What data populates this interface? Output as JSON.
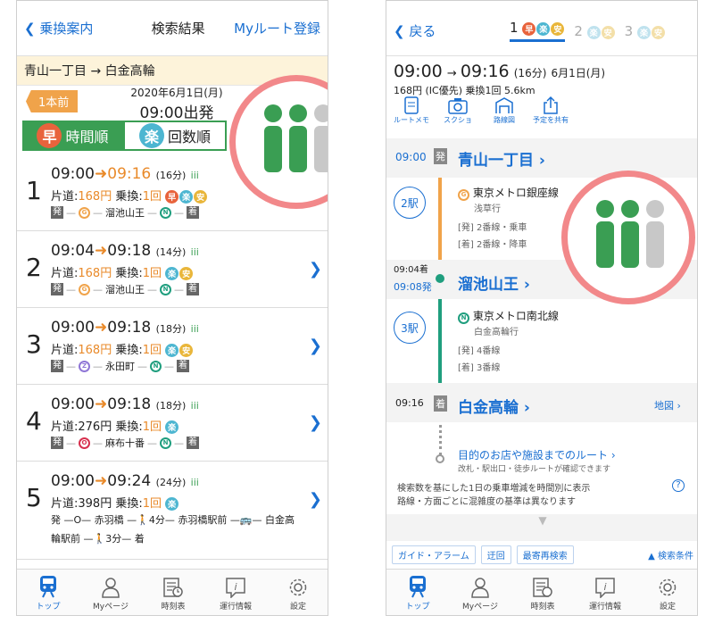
{
  "left": {
    "nav": {
      "back": "乗換案内",
      "title": "検索結果",
      "myroute": "Myルート登録"
    },
    "route": "青山一丁目 → 白金高輪",
    "prev": "1本前",
    "date": "2020年6月1日(月)",
    "depart": "09:00出発",
    "tabs": [
      {
        "badge": "早",
        "label": "時間順"
      },
      {
        "badge": "楽",
        "label": "回数順"
      }
    ],
    "routes": [
      {
        "num": "1",
        "dep": "09:00",
        "arr": "09:16",
        "dur": "(16分)",
        "fare_label": "片道:",
        "fare": "168円",
        "transfer_label": "乗換:",
        "transfer": "1回",
        "badges": [
          "早",
          "楽",
          "安"
        ],
        "arr_orange": true,
        "fare_orange": true,
        "path": [
          "発",
          "G",
          "溜池山王",
          "N",
          "着"
        ]
      },
      {
        "num": "2",
        "dep": "09:04",
        "arr": "09:18",
        "dur": "(14分)",
        "fare_label": "片道:",
        "fare": "168円",
        "transfer_label": "乗換:",
        "transfer": "1回",
        "badges": [
          "楽",
          "安"
        ],
        "arr_orange": false,
        "fare_orange": true,
        "path": [
          "発",
          "G",
          "溜池山王",
          "N",
          "着"
        ]
      },
      {
        "num": "3",
        "dep": "09:00",
        "arr": "09:18",
        "dur": "(18分)",
        "fare_label": "片道:",
        "fare": "168円",
        "transfer_label": "乗換:",
        "transfer": "1回",
        "badges": [
          "楽",
          "安"
        ],
        "arr_orange": false,
        "fare_orange": true,
        "path": [
          "発",
          "Z",
          "永田町",
          "N",
          "着"
        ]
      },
      {
        "num": "4",
        "dep": "09:00",
        "arr": "09:18",
        "dur": "(18分)",
        "fare_label": "片道:",
        "fare": "276円",
        "transfer_label": "乗換:",
        "transfer": "1回",
        "badges": [
          "楽"
        ],
        "arr_orange": false,
        "fare_orange": false,
        "path": [
          "発",
          "O",
          "麻布十番",
          "N",
          "着"
        ]
      },
      {
        "num": "5",
        "dep": "09:00",
        "arr": "09:24",
        "dur": "(24分)",
        "fare_label": "片道:",
        "fare": "398円",
        "transfer_label": "乗換:",
        "transfer": "1回",
        "badges": [
          "楽"
        ],
        "arr_orange": false,
        "fare_orange": false,
        "path5a": "発 —O— 赤羽橋 —🚶4分— 赤羽橋駅前 —🚌— 白金高",
        "path5b": "輪駅前 —🚶3分— 着"
      }
    ],
    "tabbar": [
      {
        "label": "トップ",
        "icon": "train-icon"
      },
      {
        "label": "Myページ",
        "icon": "person-icon"
      },
      {
        "label": "時刻表",
        "icon": "timetable-icon"
      },
      {
        "label": "運行情報",
        "icon": "info-icon"
      },
      {
        "label": "設定",
        "icon": "gear-icon"
      }
    ]
  },
  "right": {
    "nav": {
      "back": "戻る",
      "seg1": "1",
      "seg2": "2",
      "seg3": "3"
    },
    "summary": {
      "dep": "09:00",
      "arr": "09:16",
      "dur": "(16分)",
      "date": "6月1日(月)",
      "sub": "168円 (IC優先) 乗換1回 5.6km"
    },
    "tools": [
      "ルートメモ",
      "スクショ",
      "路線図",
      "予定を共有"
    ],
    "st1": {
      "time": "09:00",
      "mark": "発",
      "name": "青山一丁目 ›"
    },
    "leg1": {
      "count": "2駅",
      "line": "東京メトロ銀座線",
      "dir": "浅草行",
      "dep": "[発] 2番線・乗車",
      "arr": "[着] 2番線・降車"
    },
    "st2": {
      "arr": "09:04着",
      "dep": "09:08発",
      "name": "溜池山王 ›"
    },
    "leg2": {
      "count": "3駅",
      "line": "東京メトロ南北線",
      "dir": "白金高輪行",
      "dep": "[発] 4番線",
      "arr": "[着] 3番線"
    },
    "st3": {
      "time": "09:16",
      "mark": "着",
      "name": "白金高輪 ›",
      "map": "地図 ›"
    },
    "dest": {
      "title": "目的のお店や施設までのルート ›",
      "sub": "改札・駅出口・徒歩ルートが確認できます"
    },
    "note": {
      "l1": "検索数を基にした1日の乗車増減を時間別に表示",
      "l2": "路線・方面ごとに混雑度の基準は異なります"
    },
    "bottom": {
      "guide": "ガイド・アラーム",
      "detour": "迂回",
      "research": "最寄再検索",
      "cond": "▲ 検索条件"
    },
    "tabbar": [
      {
        "label": "トップ"
      },
      {
        "label": "Myページ"
      },
      {
        "label": "時刻表"
      },
      {
        "label": "運行情報"
      },
      {
        "label": "設定"
      }
    ]
  },
  "colors": {
    "accent": "#1a6fd1",
    "green": "#3a9e53",
    "orange": "#e98a2a",
    "pink": "#f2888a"
  }
}
